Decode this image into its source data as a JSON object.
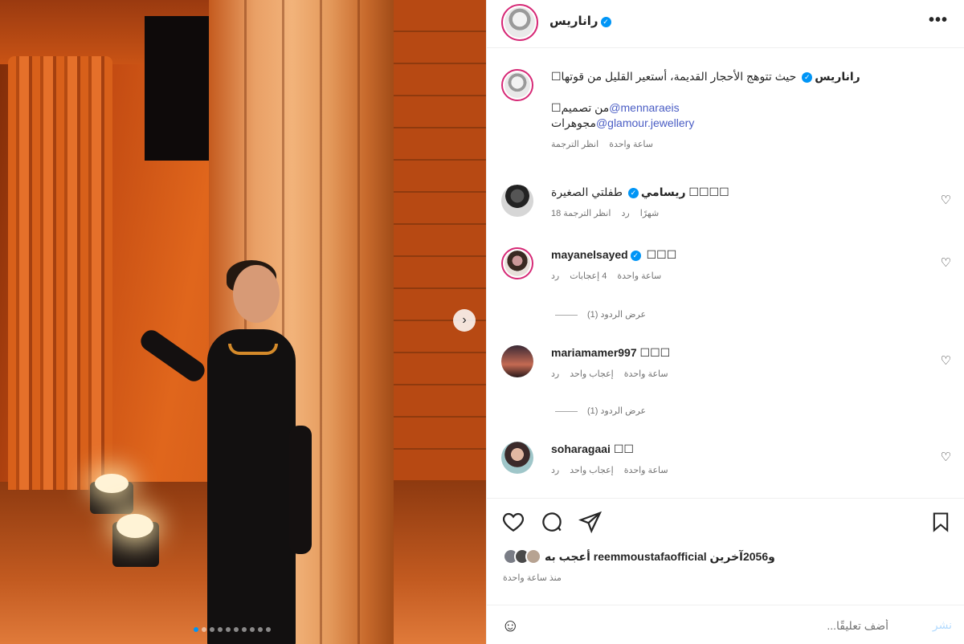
{
  "post": {
    "username": "راناريس",
    "more_label": "•••",
    "caption": "حيث تتوهج الأحجار القديمة، أستعير القليل من قوتها☐",
    "credit_line1_mention": "@mennaraeis",
    "credit_line1_text": "☐من تصميم",
    "credit_line2_mention": "@glamour.jewellery",
    "credit_line2_text": "مجوهرات",
    "caption_meta_translate": "انظر الترجمة",
    "caption_meta_time": "ساعة واحدة",
    "next_icon": "›"
  },
  "comments": [
    {
      "username": "ريسامي",
      "text": "طفلتي الصغيرة ☐☐☐☐",
      "time": "18 شهرًا",
      "reply": "رد",
      "translate": "انظر الترجمة"
    },
    {
      "username": "mayanelsayed",
      "text": "☐☐☐",
      "time": "ساعة واحدة",
      "likes": "4 إعجابات",
      "reply": "رد",
      "replies": "عرض الردود (1)"
    },
    {
      "username": "mariamamer997",
      "text": "☐☐☐",
      "time": "ساعة واحدة",
      "likes": "إعجاب واحد",
      "reply": "رد",
      "replies": "عرض الردود (1)"
    },
    {
      "username": "soharagaai",
      "text": "☐☐",
      "time": "ساعة واحدة",
      "likes": "إعجاب واحد",
      "reply": "رد"
    }
  ],
  "actions": {
    "likes_text": "أعجب به reemmoustafaofficial و2056آخرين",
    "time": "منذ ساعة واحدة",
    "comment_placeholder": "أضف تعليقًا...",
    "post_label": "نشر",
    "emoji_icon": "☺"
  },
  "colors": {
    "accent": "#0095f6",
    "link": "#4a5dc4",
    "ring": "#d62976"
  }
}
